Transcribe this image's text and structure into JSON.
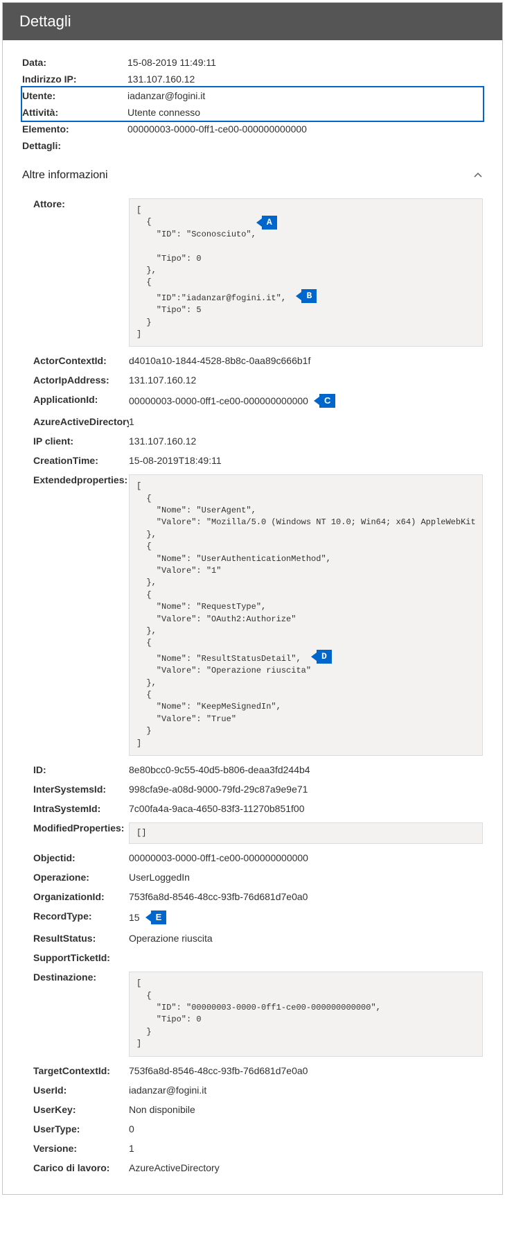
{
  "header": {
    "title": "Dettagli"
  },
  "fields": {
    "data_label": "Data:",
    "data_value": "15-08-2019 11:49:11",
    "ip_label": "Indirizzo IP:",
    "ip_value": "131.107.160.12",
    "user_label": "Utente:",
    "user_value": "iadanzar@fogini.it",
    "activity_label": "Attività:",
    "activity_value": "Utente connesso",
    "elemento_label": "Elemento:",
    "elemento_value": "00000003-0000-0ff1-ce00-000000000000",
    "dettagli_label": "Dettagli:"
  },
  "section": {
    "title": "Altre informazioni"
  },
  "sub": {
    "attore_label": "Attore:",
    "attore_code_pre": "[\n  {\n    \"ID\": \"Sconosciuto\",",
    "attore_code_mid": "    \"Tipo\": 0\n  },\n  {\n    \"ID\":\"iadanzar@fogini.it\",",
    "attore_code_post": "    \"Tipo\": 5\n  }\n]",
    "actorcontext_label": "ActorContextId:",
    "actorcontext_value": "d4010a10-1844-4528-8b8c-0aa89c666b1f",
    "actorip_label": "ActorIpAddress:",
    "actorip_value": "131.107.160.12",
    "appid_label": "ApplicationId:",
    "appid_value": "00000003-0000-0ff1-ce00-000000000000",
    "aad_label": "AzureActiveDirectoryEventType:",
    "aad_value": "1",
    "ipclient_label": "IP client:",
    "ipclient_value": "131.107.160.12",
    "creation_label": "CreationTime:",
    "creation_value": "15-08-2019T18:49:11",
    "ext_label": "Extendedproperties:",
    "ext_code_pre": "[\n  {\n    \"Nome\": \"UserAgent\",\n    \"Valore\": \"Mozilla/5.0 (Windows NT 10.0; Win64; x64) AppleWebKit\n  },\n  {\n    \"Nome\": \"UserAuthenticationMethod\",\n    \"Valore\": \"1\"\n  },\n  {\n    \"Nome\": \"RequestType\",\n    \"Valore\": \"OAuth2:Authorize\"\n  },\n  {\n    \"Nome\": \"ResultStatusDetail\",",
    "ext_code_post": "    \"Valore\": \"Operazione riuscita\"\n  },\n  {\n    \"Nome\": \"KeepMeSignedIn\",\n    \"Valore\": \"True\"\n  }\n]",
    "id_label": "ID:",
    "id_value": "8e80bcc0-9c55-40d5-b806-deaa3fd244b4",
    "inter_label": "InterSystemsId:",
    "inter_value": "998cfa9e-a08d-9000-79fd-29c87a9e9e71",
    "intra_label": "IntraSystemId:",
    "intra_value": "7c00fa4a-9aca-4650-83f3-11270b851f00",
    "mod_label": "ModifiedProperties:",
    "mod_value": "[]",
    "obj_label": "Objectid:",
    "obj_value": "00000003-0000-0ff1-ce00-000000000000",
    "op_label": "Operazione:",
    "op_value": "UserLoggedIn",
    "org_label": "OrganizationId:",
    "org_value": "753f6a8d-8546-48cc-93fb-76d681d7e0a0",
    "rt_label": "RecordType:",
    "rt_value": "15",
    "rs_label": "ResultStatus:",
    "rs_value": "Operazione riuscita",
    "ticket_label": "SupportTicketId:",
    "dest_label": "Destinazione:",
    "dest_code": "[\n  {\n    \"ID\": \"00000003-0000-0ff1-ce00-000000000000\",\n    \"Tipo\": 0\n  }\n]",
    "tctx_label": "TargetContextId:",
    "tctx_value": "753f6a8d-8546-48cc-93fb-76d681d7e0a0",
    "uid_label": "UserId:",
    "uid_value": "iadanzar@fogini.it",
    "ukey_label": "UserKey:",
    "ukey_value": "Non disponibile",
    "utype_label": "UserType:",
    "utype_value": "0",
    "ver_label": "Versione:",
    "ver_value": "1",
    "work_label": "Carico di lavoro:",
    "work_value": "AzureActiveDirectory"
  },
  "callouts": {
    "a": "A",
    "b": "B",
    "c": "C",
    "d": "D",
    "e": "E"
  }
}
